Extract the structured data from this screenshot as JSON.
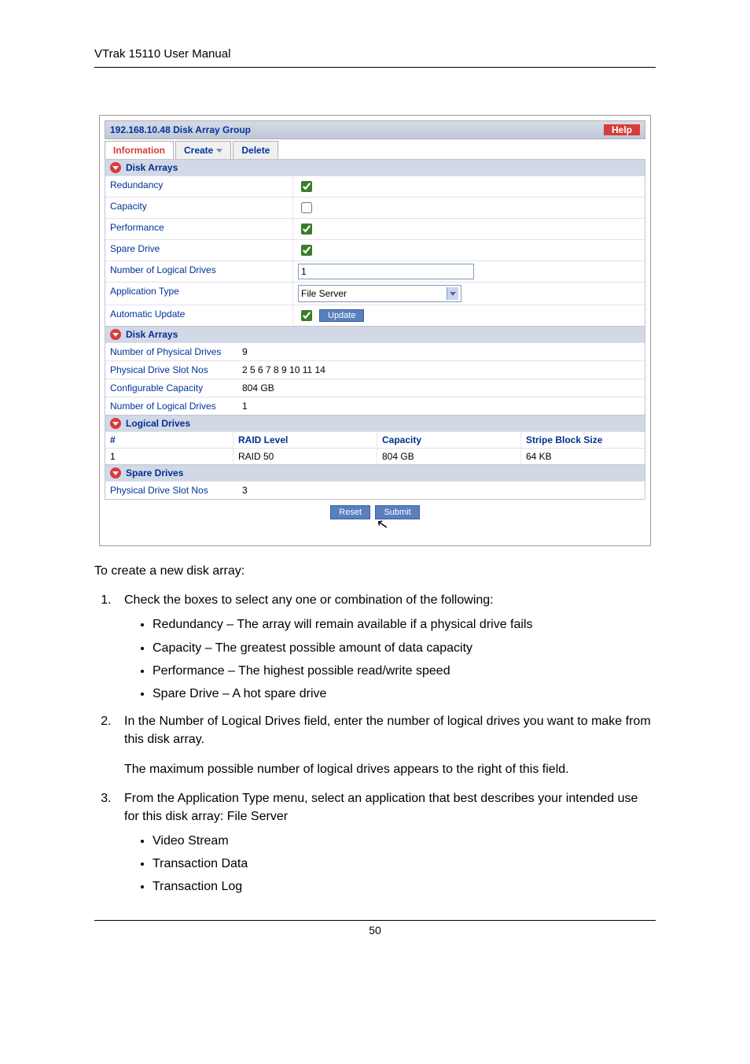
{
  "header": "VTrak 15110 User Manual",
  "titlebar": {
    "title": "192.168.10.48 Disk Array Group",
    "help": "Help"
  },
  "tabs": {
    "information": "Information",
    "create": "Create",
    "delete": "Delete"
  },
  "section1": {
    "title": "Disk Arrays",
    "redundancy": "Redundancy",
    "capacity": "Capacity",
    "performance": "Performance",
    "spare": "Spare Drive",
    "numLogical": "Number of Logical Drives",
    "numLogicalValue": "1",
    "appType": "Application Type",
    "appTypeValue": "File Server",
    "autoUpdate": "Automatic Update",
    "updateBtn": "Update"
  },
  "section2": {
    "title": "Disk Arrays",
    "numPhysLabel": "Number of Physical Drives",
    "numPhysValue": "9",
    "slotLabel": "Physical Drive Slot Nos",
    "slotValue": "2 5 6 7 8 9 10 11 14",
    "capLabel": "Configurable Capacity",
    "capValue": "804 GB",
    "numLogLabel": "Number of Logical Drives",
    "numLogValue": "1"
  },
  "section3": {
    "title": "Logical Drives",
    "headers": {
      "num": "#",
      "raid": "RAID Level",
      "capacity": "Capacity",
      "stripe": "Stripe Block Size"
    },
    "row": {
      "num": "1",
      "raid": "RAID 50",
      "capacity": "804 GB",
      "stripe": "64 KB"
    }
  },
  "section4": {
    "title": "Spare Drives",
    "slotLabel": "Physical Drive Slot Nos",
    "slotValue": "3"
  },
  "buttons": {
    "reset": "Reset",
    "submit": "Submit"
  },
  "body": {
    "intro": "To create a new disk array:",
    "step1": "Check the boxes to select any one or combination of the following:",
    "s1b1": "Redundancy – The array will remain available if a physical drive fails",
    "s1b2": "Capacity – The greatest possible amount of data capacity",
    "s1b3": "Performance – The highest possible read/write speed",
    "s1b4": "Spare Drive – A hot spare drive",
    "step2a": "In the Number of Logical Drives field, enter the number of logical drives you want to make from this disk array.",
    "step2b": "The maximum possible number of logical drives appears to the right of this field.",
    "step3": "From the Application Type menu, select an application that best describes your intended use for this disk array: File Server",
    "s3b1": "Video Stream",
    "s3b2": "Transaction Data",
    "s3b3": "Transaction Log"
  },
  "footer": "50"
}
